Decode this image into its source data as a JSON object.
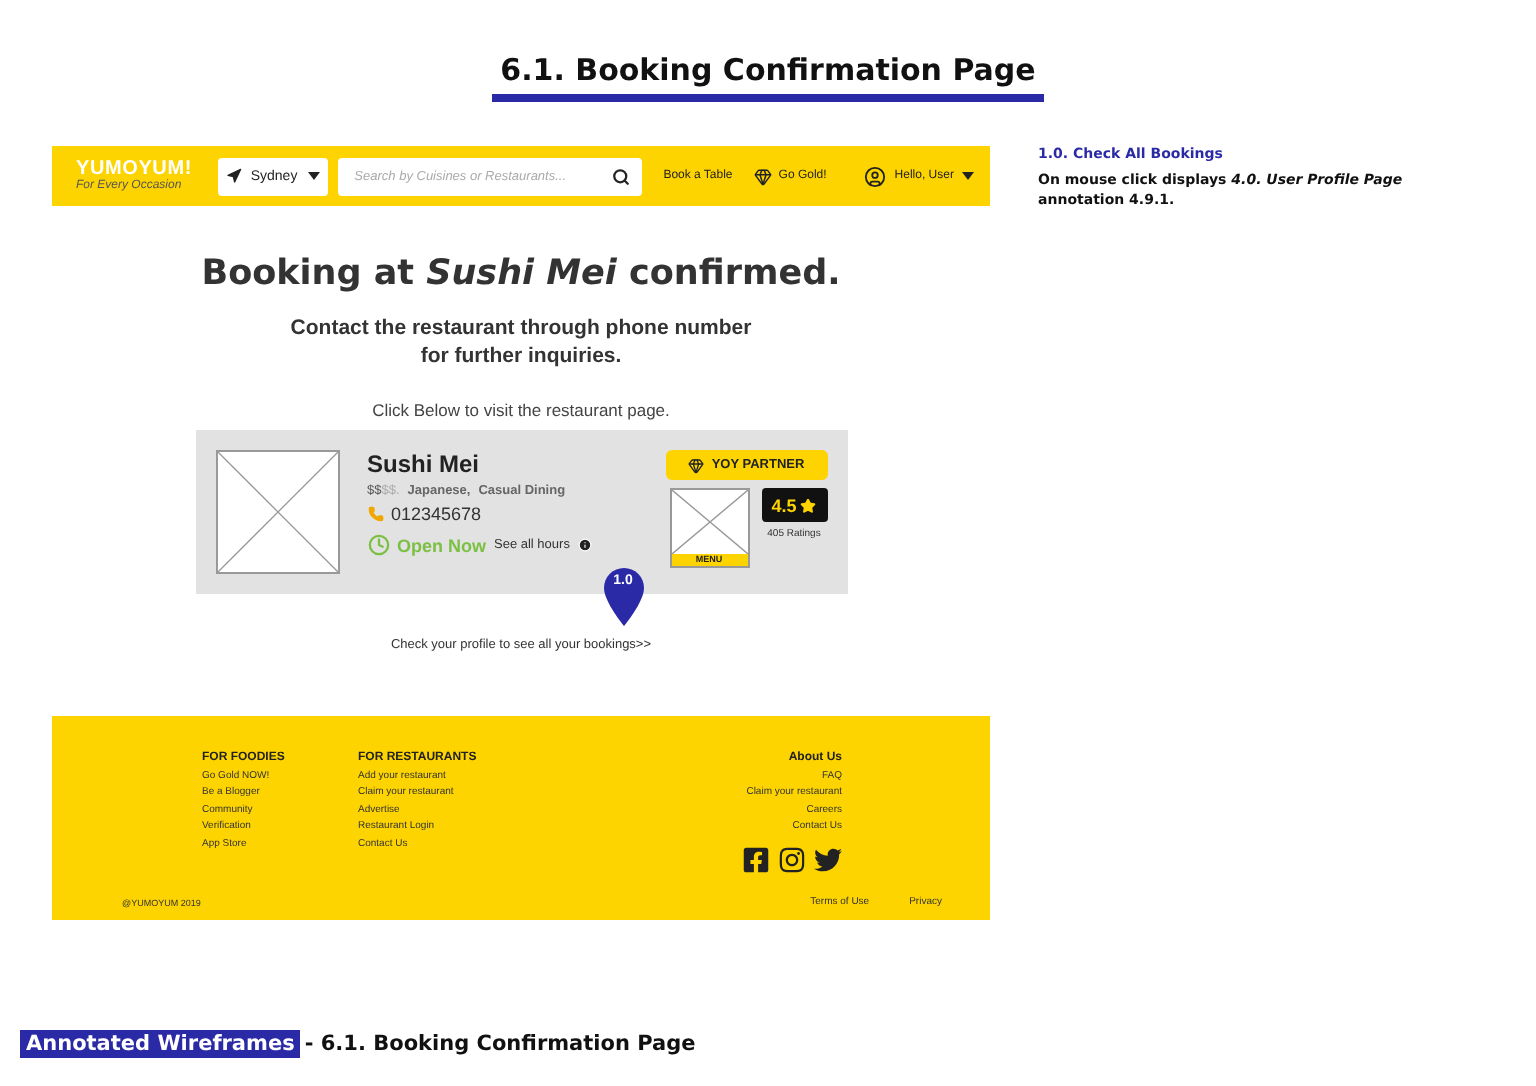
{
  "title": "6.1. Booking Confirmation Page",
  "header": {
    "logo": "YUMOYUM!",
    "tagline": "For Every Occasion",
    "location": "Sydney",
    "search": {
      "placeholder": "Search by Cuisines or Restaurants..."
    },
    "links": [
      "Book a Table",
      "Go Gold!"
    ],
    "user": "Hello, User"
  },
  "confirmation": {
    "heading": "Booking at *Sushi Mei* confirmed.",
    "message": "Contact the restaurant through phone number for further inquiries.",
    "prompt": "Click Below to visit the restaurant page."
  },
  "restaurant": {
    "name": "Sushi Mei",
    "price_on": "$$",
    "price_off": "$$.",
    "cuisine": "Japanese,",
    "type": "Casual Dining",
    "phone": "012345678",
    "open": true,
    "status": "Open Now",
    "hours_link": "See all hours",
    "badge": "YOY PARTNER",
    "menu": "MENU",
    "rating": "4.5",
    "ratings_count": "405 Ratings"
  },
  "marker": "1.0",
  "profile_link": "Check your profile to see all your bookings>>",
  "footer": {
    "columns": [
      {
        "heading": "FOR FOODIES",
        "links": [
          "Go Gold NOW!",
          "Be a Blogger",
          "Community",
          "Verification",
          "App Store"
        ]
      },
      {
        "heading": "FOR RESTAURANTS",
        "links": [
          "Add your restaurant",
          "Claim your restaurant",
          "Advertise",
          "Restaurant Login",
          "Contact Us"
        ]
      }
    ],
    "about": {
      "heading": "About Us",
      "links": [
        "FAQ",
        "Claim your restaurant",
        "Careers",
        "Contact Us"
      ]
    },
    "copyright": "@YUMOYUM 2019",
    "legal": [
      "Terms of Use",
      "Privacy"
    ]
  },
  "annotation": {
    "title": "1.0. Check All Bookings",
    "text": "On mouse click displays *4.0. User Profile Page* annotation 4.9.1."
  },
  "caption": {
    "tag": "Annotated Wireframes",
    "text": "- 6.1. Booking Confirmation Page"
  }
}
